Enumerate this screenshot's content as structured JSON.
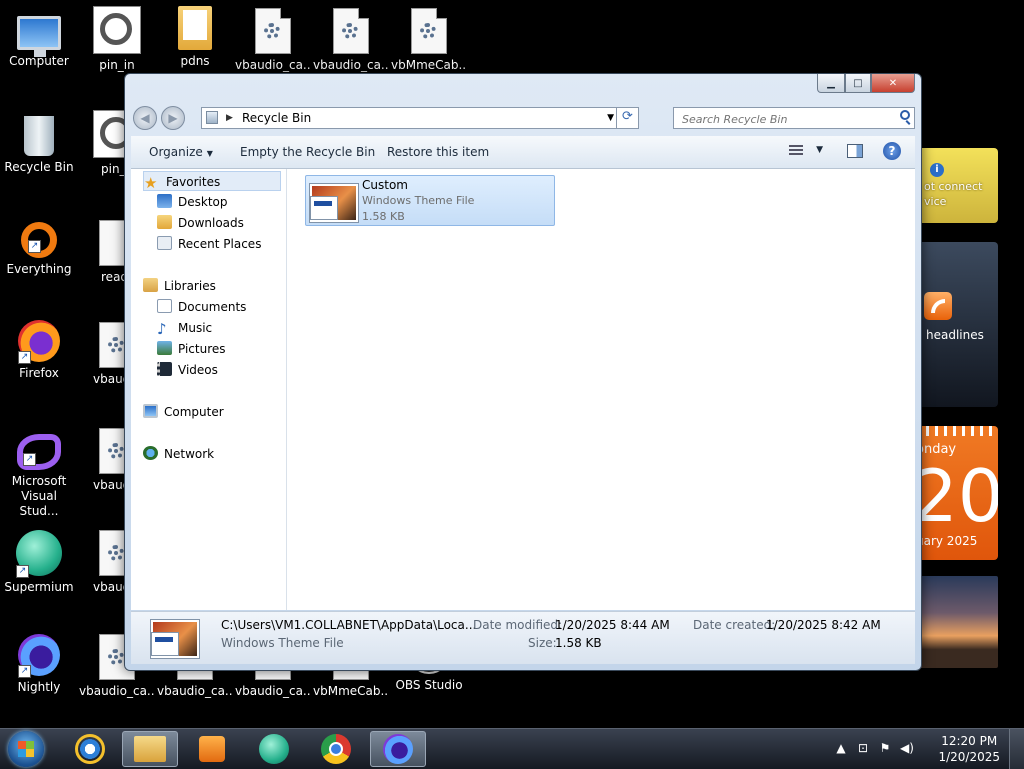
{
  "desktop": {
    "icons": [
      {
        "label": "Computer",
        "icon": "computer-icon"
      },
      {
        "label": "pin_in",
        "icon": "pin-image-icon"
      },
      {
        "label": "pdns",
        "icon": "folder-icon"
      },
      {
        "label": "vbaudio_ca...",
        "icon": "settings-file-icon"
      },
      {
        "label": "vbaudio_ca...",
        "icon": "settings-file-icon"
      },
      {
        "label": "vbMmeCab...",
        "icon": "settings-file-icon"
      },
      {
        "label": "Recycle Bin",
        "icon": "recycle-bin-icon"
      },
      {
        "label": "pin_o",
        "icon": "pin-image-icon"
      },
      {
        "label": "Everything",
        "icon": "everything-icon"
      },
      {
        "label": "readr",
        "icon": "text-file-icon"
      },
      {
        "label": "Firefox",
        "icon": "firefox-icon"
      },
      {
        "label": "vbaudio",
        "icon": "settings-file-icon"
      },
      {
        "label": "Microsoft Visual Stud...",
        "icon": "visual-studio-icon"
      },
      {
        "label": "vbaudio",
        "icon": "settings-file-icon"
      },
      {
        "label": "Supermium",
        "icon": "supermium-icon"
      },
      {
        "label": "vbaudio",
        "icon": "settings-file-icon"
      },
      {
        "label": "Nightly",
        "icon": "nightly-icon"
      },
      {
        "label": "vbaudio_ca...",
        "icon": "settings-file-icon"
      },
      {
        "label": "vbaudio_ca...",
        "icon": "settings-file-icon"
      },
      {
        "label": "vbaudio_ca...",
        "icon": "settings-file-icon"
      },
      {
        "label": "vbMmeCab...",
        "icon": "settings-file-icon"
      },
      {
        "label": "OBS Studio",
        "icon": "obs-icon"
      }
    ]
  },
  "gadgets": {
    "weather": {
      "line1": "ot connect",
      "line2": "vice"
    },
    "feeds": {
      "label": "headlines"
    },
    "calendar": {
      "day": "onday",
      "date": "20",
      "month": "uary 2025"
    }
  },
  "explorer": {
    "address": {
      "path": "Recycle Bin"
    },
    "search": {
      "placeholder": "Search Recycle Bin"
    },
    "toolbar": {
      "organize": "Organize",
      "empty": "Empty the Recycle Bin",
      "restore": "Restore this item"
    },
    "nav": {
      "favorites": "Favorites",
      "desktop": "Desktop",
      "downloads": "Downloads",
      "recent": "Recent Places",
      "libraries": "Libraries",
      "documents": "Documents",
      "music": "Music",
      "pictures": "Pictures",
      "videos": "Videos",
      "computer": "Computer",
      "network": "Network"
    },
    "file": {
      "name": "Custom",
      "type": "Windows Theme File",
      "size": "1.58 KB"
    },
    "details": {
      "path": "C:\\Users\\VM1.COLLABNET\\AppData\\Loca...",
      "type": "Windows Theme File",
      "modified_label": "Date modified:",
      "modified": "1/20/2025 8:44 AM",
      "size_label": "Size:",
      "size": "1.58 KB",
      "created_label": "Date created:",
      "created": "1/20/2025 8:42 AM"
    }
  },
  "taskbar": {
    "clock": {
      "time": "12:20 PM",
      "date": "1/20/2025"
    }
  }
}
